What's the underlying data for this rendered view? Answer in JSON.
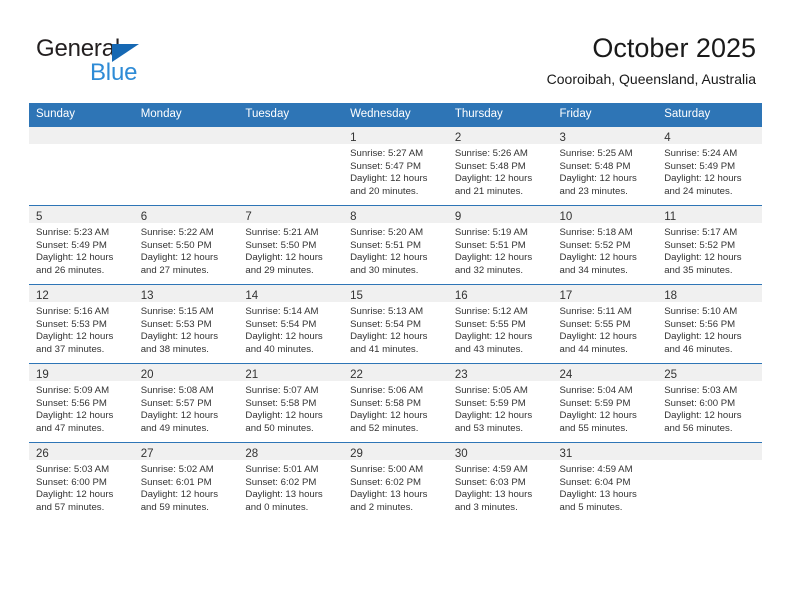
{
  "brand": {
    "word_one": "General",
    "word_two": "Blue",
    "triangle_color": "#1668b3",
    "blue_text_color": "#2e8bd6"
  },
  "header": {
    "title": "October 2025",
    "subtitle": "Cooroibah, Queensland, Australia",
    "accent_color": "#2e75b6"
  },
  "calendar": {
    "weekday_headers": [
      "Sunday",
      "Monday",
      "Tuesday",
      "Wednesday",
      "Thursday",
      "Friday",
      "Saturday"
    ],
    "weeks": [
      [
        {
          "day": "",
          "lines": []
        },
        {
          "day": "",
          "lines": []
        },
        {
          "day": "",
          "lines": []
        },
        {
          "day": "1",
          "lines": [
            "Sunrise: 5:27 AM",
            "Sunset: 5:47 PM",
            "Daylight: 12 hours",
            "and 20 minutes."
          ]
        },
        {
          "day": "2",
          "lines": [
            "Sunrise: 5:26 AM",
            "Sunset: 5:48 PM",
            "Daylight: 12 hours",
            "and 21 minutes."
          ]
        },
        {
          "day": "3",
          "lines": [
            "Sunrise: 5:25 AM",
            "Sunset: 5:48 PM",
            "Daylight: 12 hours",
            "and 23 minutes."
          ]
        },
        {
          "day": "4",
          "lines": [
            "Sunrise: 5:24 AM",
            "Sunset: 5:49 PM",
            "Daylight: 12 hours",
            "and 24 minutes."
          ]
        }
      ],
      [
        {
          "day": "5",
          "lines": [
            "Sunrise: 5:23 AM",
            "Sunset: 5:49 PM",
            "Daylight: 12 hours",
            "and 26 minutes."
          ]
        },
        {
          "day": "6",
          "lines": [
            "Sunrise: 5:22 AM",
            "Sunset: 5:50 PM",
            "Daylight: 12 hours",
            "and 27 minutes."
          ]
        },
        {
          "day": "7",
          "lines": [
            "Sunrise: 5:21 AM",
            "Sunset: 5:50 PM",
            "Daylight: 12 hours",
            "and 29 minutes."
          ]
        },
        {
          "day": "8",
          "lines": [
            "Sunrise: 5:20 AM",
            "Sunset: 5:51 PM",
            "Daylight: 12 hours",
            "and 30 minutes."
          ]
        },
        {
          "day": "9",
          "lines": [
            "Sunrise: 5:19 AM",
            "Sunset: 5:51 PM",
            "Daylight: 12 hours",
            "and 32 minutes."
          ]
        },
        {
          "day": "10",
          "lines": [
            "Sunrise: 5:18 AM",
            "Sunset: 5:52 PM",
            "Daylight: 12 hours",
            "and 34 minutes."
          ]
        },
        {
          "day": "11",
          "lines": [
            "Sunrise: 5:17 AM",
            "Sunset: 5:52 PM",
            "Daylight: 12 hours",
            "and 35 minutes."
          ]
        }
      ],
      [
        {
          "day": "12",
          "lines": [
            "Sunrise: 5:16 AM",
            "Sunset: 5:53 PM",
            "Daylight: 12 hours",
            "and 37 minutes."
          ]
        },
        {
          "day": "13",
          "lines": [
            "Sunrise: 5:15 AM",
            "Sunset: 5:53 PM",
            "Daylight: 12 hours",
            "and 38 minutes."
          ]
        },
        {
          "day": "14",
          "lines": [
            "Sunrise: 5:14 AM",
            "Sunset: 5:54 PM",
            "Daylight: 12 hours",
            "and 40 minutes."
          ]
        },
        {
          "day": "15",
          "lines": [
            "Sunrise: 5:13 AM",
            "Sunset: 5:54 PM",
            "Daylight: 12 hours",
            "and 41 minutes."
          ]
        },
        {
          "day": "16",
          "lines": [
            "Sunrise: 5:12 AM",
            "Sunset: 5:55 PM",
            "Daylight: 12 hours",
            "and 43 minutes."
          ]
        },
        {
          "day": "17",
          "lines": [
            "Sunrise: 5:11 AM",
            "Sunset: 5:55 PM",
            "Daylight: 12 hours",
            "and 44 minutes."
          ]
        },
        {
          "day": "18",
          "lines": [
            "Sunrise: 5:10 AM",
            "Sunset: 5:56 PM",
            "Daylight: 12 hours",
            "and 46 minutes."
          ]
        }
      ],
      [
        {
          "day": "19",
          "lines": [
            "Sunrise: 5:09 AM",
            "Sunset: 5:56 PM",
            "Daylight: 12 hours",
            "and 47 minutes."
          ]
        },
        {
          "day": "20",
          "lines": [
            "Sunrise: 5:08 AM",
            "Sunset: 5:57 PM",
            "Daylight: 12 hours",
            "and 49 minutes."
          ]
        },
        {
          "day": "21",
          "lines": [
            "Sunrise: 5:07 AM",
            "Sunset: 5:58 PM",
            "Daylight: 12 hours",
            "and 50 minutes."
          ]
        },
        {
          "day": "22",
          "lines": [
            "Sunrise: 5:06 AM",
            "Sunset: 5:58 PM",
            "Daylight: 12 hours",
            "and 52 minutes."
          ]
        },
        {
          "day": "23",
          "lines": [
            "Sunrise: 5:05 AM",
            "Sunset: 5:59 PM",
            "Daylight: 12 hours",
            "and 53 minutes."
          ]
        },
        {
          "day": "24",
          "lines": [
            "Sunrise: 5:04 AM",
            "Sunset: 5:59 PM",
            "Daylight: 12 hours",
            "and 55 minutes."
          ]
        },
        {
          "day": "25",
          "lines": [
            "Sunrise: 5:03 AM",
            "Sunset: 6:00 PM",
            "Daylight: 12 hours",
            "and 56 minutes."
          ]
        }
      ],
      [
        {
          "day": "26",
          "lines": [
            "Sunrise: 5:03 AM",
            "Sunset: 6:00 PM",
            "Daylight: 12 hours",
            "and 57 minutes."
          ]
        },
        {
          "day": "27",
          "lines": [
            "Sunrise: 5:02 AM",
            "Sunset: 6:01 PM",
            "Daylight: 12 hours",
            "and 59 minutes."
          ]
        },
        {
          "day": "28",
          "lines": [
            "Sunrise: 5:01 AM",
            "Sunset: 6:02 PM",
            "Daylight: 13 hours",
            "and 0 minutes."
          ]
        },
        {
          "day": "29",
          "lines": [
            "Sunrise: 5:00 AM",
            "Sunset: 6:02 PM",
            "Daylight: 13 hours",
            "and 2 minutes."
          ]
        },
        {
          "day": "30",
          "lines": [
            "Sunrise: 4:59 AM",
            "Sunset: 6:03 PM",
            "Daylight: 13 hours",
            "and 3 minutes."
          ]
        },
        {
          "day": "31",
          "lines": [
            "Sunrise: 4:59 AM",
            "Sunset: 6:04 PM",
            "Daylight: 13 hours",
            "and 5 minutes."
          ]
        },
        {
          "day": "",
          "lines": []
        }
      ]
    ]
  }
}
